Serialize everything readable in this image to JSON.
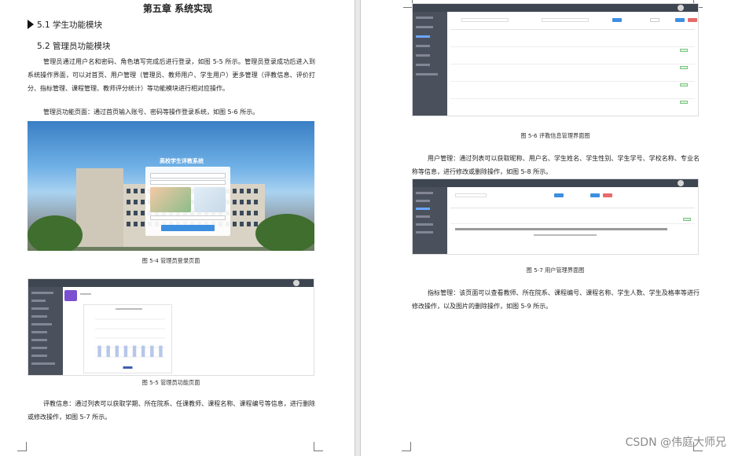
{
  "left_page": {
    "chapter_title": "第五章 系统实现",
    "section_51": "5.1 学生功能模块",
    "section_52": "5.2 管理员功能模块",
    "para_login": "管理员通过用户名和密码、角色填写完成后进行登录，如图 5-5 所示。管理员登录成功后进入到系统操作界面，可以对首页、用户管理（管理员、教师用户、学生用户）更多管理（评教信息、评价打分、指标管理、课程管理、教师评分统计）等功能模块进行相对应操作。",
    "para_function": "管理员功能页面：通过首页输入账号、密码等操作登录系统，如图 5-6 所示。",
    "login_screen_title": "高校学生评教系统",
    "caption_login": "图 5-4 管理员登录页面",
    "caption_function": "图 5-5 管理员功能页面",
    "para_evaluation": "评教信息：通过列表可以获取学期、所在院系、任课教师、课程名称、课程编号等信息，进行删除或修改操作，如图 5-7 所示。"
  },
  "right_page": {
    "caption_eval_mgmt": "图 5-6 评教信息管理界面图",
    "para_user_mgmt": "用户管理：通过列表可以获取昵称、用户名、学生姓名、学生性别、学生学号、学校名称、专业名称等信息，进行修改或删除操作，如图 5-8 所示。",
    "caption_user_mgmt": "图 5-7 用户管理界面图",
    "para_indicator": "指标管理：该页面可以查看教师、所在院系、课程编号、课程名称、学生人数、学生及格率等进行修改操作，以及图片的删除操作，如图 5-9 所示。"
  },
  "watermark": "CSDN @伟庭大师兄",
  "colors": {
    "accent_blue": "#3d8fe0",
    "danger_red": "#e86a6a",
    "sidebar_dark": "#4a515c",
    "topbar_dark": "#3e4651"
  },
  "chart_data": {
    "type": "bar",
    "categories": [
      "",
      "",
      "",
      "",
      "",
      "",
      "",
      ""
    ],
    "series": [
      {
        "values": [
          3,
          3,
          3,
          3,
          3,
          3,
          3,
          3
        ]
      }
    ]
  }
}
